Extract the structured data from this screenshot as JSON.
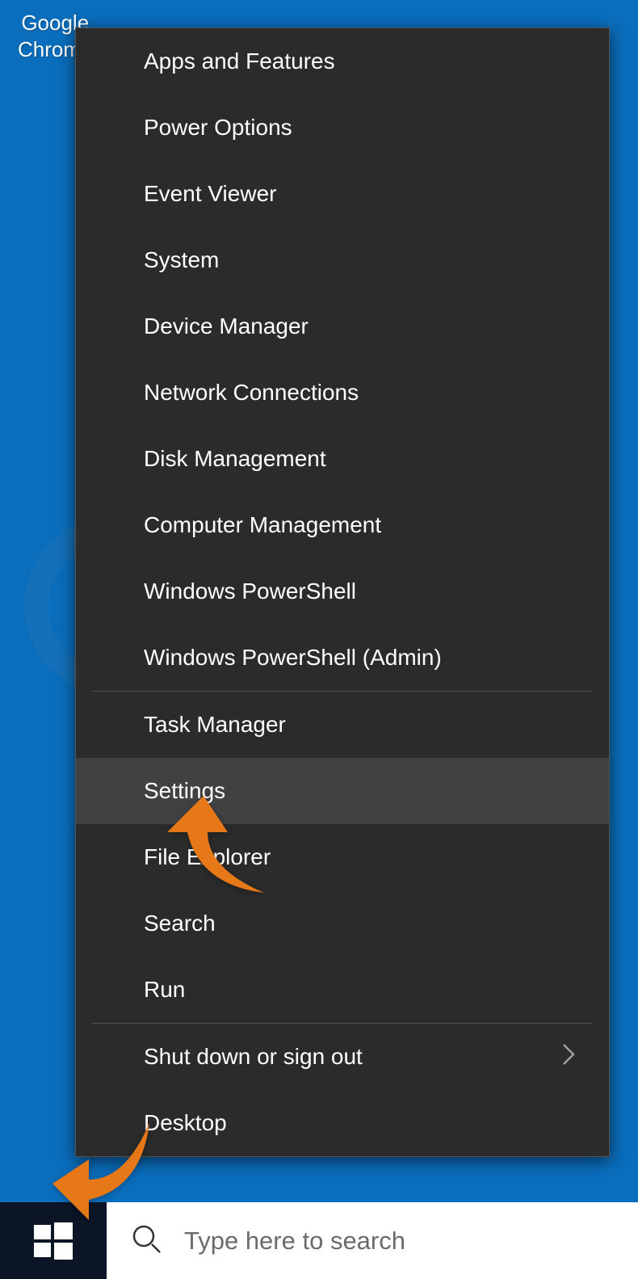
{
  "desktop_icon": {
    "line1": "Google",
    "line2": "Chrome"
  },
  "context_menu": {
    "groups": [
      [
        {
          "label": "Apps and Features",
          "has_submenu": false
        },
        {
          "label": "Power Options",
          "has_submenu": false
        },
        {
          "label": "Event Viewer",
          "has_submenu": false
        },
        {
          "label": "System",
          "has_submenu": false
        },
        {
          "label": "Device Manager",
          "has_submenu": false
        },
        {
          "label": "Network Connections",
          "has_submenu": false
        },
        {
          "label": "Disk Management",
          "has_submenu": false
        },
        {
          "label": "Computer Management",
          "has_submenu": false
        },
        {
          "label": "Windows PowerShell",
          "has_submenu": false
        },
        {
          "label": "Windows PowerShell (Admin)",
          "has_submenu": false
        }
      ],
      [
        {
          "label": "Task Manager",
          "has_submenu": false
        },
        {
          "label": "Settings",
          "has_submenu": false,
          "highlighted": true
        },
        {
          "label": "File Explorer",
          "has_submenu": false
        },
        {
          "label": "Search",
          "has_submenu": false
        },
        {
          "label": "Run",
          "has_submenu": false
        }
      ],
      [
        {
          "label": "Shut down or sign out",
          "has_submenu": true
        },
        {
          "label": "Desktop",
          "has_submenu": false
        }
      ]
    ]
  },
  "search": {
    "placeholder": "Type here to search"
  },
  "annotations": {
    "arrow_color": "#e67817"
  }
}
